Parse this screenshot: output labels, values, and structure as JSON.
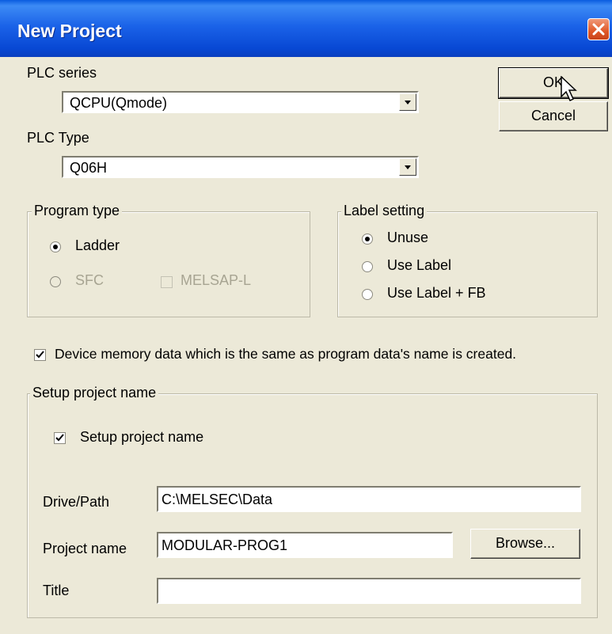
{
  "window": {
    "title": "New Project"
  },
  "plc_series": {
    "label": "PLC series",
    "value": "QCPU(Qmode)"
  },
  "plc_type": {
    "label": "PLC Type",
    "value": "Q06H"
  },
  "buttons": {
    "ok": "OK",
    "cancel": "Cancel",
    "browse": "Browse..."
  },
  "program_type": {
    "legend": "Program type",
    "ladder": "Ladder",
    "sfc": "SFC",
    "melsap": "MELSAP-L",
    "selected": "Ladder"
  },
  "label_setting": {
    "legend": "Label setting",
    "options": [
      "Unuse",
      "Use Label",
      "Use Label + FB"
    ],
    "selected": "Unuse"
  },
  "device_memory": {
    "label": "Device memory data which is the same as program data's name is created.",
    "checked": true
  },
  "setup_project": {
    "legend": "Setup project name",
    "checkbox_label": "Setup project name",
    "checked": true,
    "drive_path_label": "Drive/Path",
    "drive_path_value": "C:\\MELSEC\\Data",
    "project_name_label": "Project name",
    "project_name_value": "MODULAR-PROG1",
    "title_label": "Title",
    "title_value": ""
  },
  "icons": {
    "close": "close-icon",
    "cursor": "mouse-pointer-icon",
    "check": "checkmark-icon"
  }
}
